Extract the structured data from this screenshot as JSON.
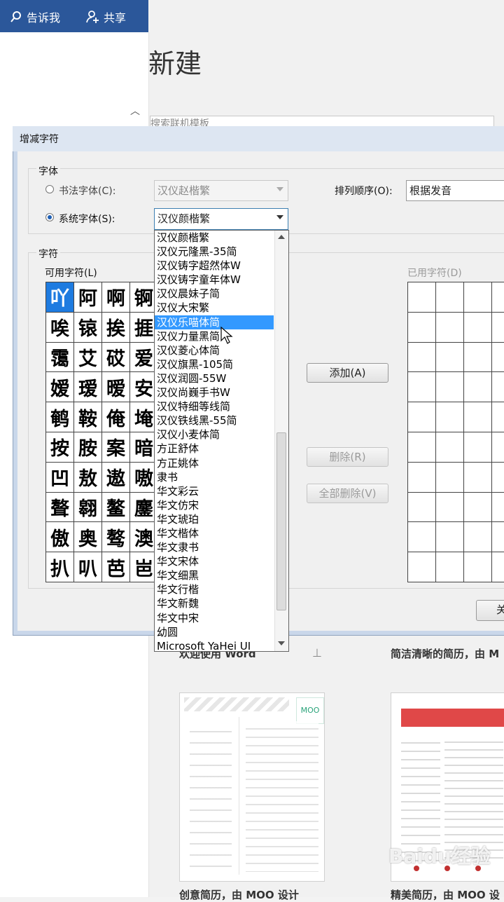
{
  "topbar": {
    "tell_me": "告诉我",
    "share": "共享"
  },
  "backstage": {
    "title": "新建",
    "search_placeholder": "搜索联机模板",
    "templates": [
      {
        "caption": "欢迎使用 Word"
      },
      {
        "caption": "简洁清晰的简历，由 M"
      },
      {
        "caption": "创意简历，由 MOO 设计"
      },
      {
        "caption": "精美简历，由 MOO 设"
      }
    ],
    "moo_logo": "MOO"
  },
  "dialog": {
    "title": "增减字符",
    "font_group_label": "字体",
    "calligraphy_radio": "书法字体(C):",
    "calligraphy_value": "汉仪赵楷繁",
    "system_radio": "系统字体(S):",
    "system_value": "汉仪颜楷繁",
    "sort_label": "排列顺序(O):",
    "sort_value": "根据发音",
    "chars_group_label": "字符",
    "available_label": "可用字符(L)",
    "used_label": "已用字符(D)",
    "add_button": "添加(A)",
    "delete_button": "删除(R)",
    "delete_all_button": "全部删除(V)",
    "close_button_fragment": "关",
    "available_chars": [
      "吖",
      "阿",
      "啊",
      "锕",
      "唉",
      "锿",
      "挨",
      "捱",
      "霭",
      "艾",
      "砹",
      "爱",
      "嫒",
      "瑷",
      "暧",
      "安",
      "鹌",
      "鞍",
      "俺",
      "埯",
      "按",
      "胺",
      "案",
      "暗",
      "凹",
      "敖",
      "遨",
      "嗷",
      "聱",
      "翱",
      "鳌",
      "鏖",
      "傲",
      "奥",
      "骜",
      "澳",
      "扒",
      "叭",
      "芭",
      "岜"
    ],
    "font_list": [
      "汉仪颜楷繁",
      "汉仪元隆黑-35简",
      "汉仪铸字超然体W",
      "汉仪铸字童年体W",
      "汉仪晨妹子简",
      "汉仪大宋繁",
      "汉仪乐喵体简",
      "汉仪力量黑简",
      "汉仪菱心体简",
      "汉仪旗黑-105简",
      "汉仪润圆-55W",
      "汉仪尚巍手书W",
      "汉仪特细等线简",
      "汉仪铁线黑-55简",
      "汉仪小麦体简",
      "方正舒体",
      "方正姚体",
      "隶书",
      "华文彩云",
      "华文仿宋",
      "华文琥珀",
      "华文楷体",
      "华文隶书",
      "华文宋体",
      "华文细黑",
      "华文行楷",
      "华文新魏",
      "华文中宋",
      "幼圆",
      "Microsoft YaHei UI"
    ],
    "highlighted_index": 6
  },
  "watermark": "Baidu经验",
  "colors": {
    "word_blue": "#2b579a",
    "highlight": "#3399ff",
    "moo_green": "#2aa37a",
    "red_banner": "#e04848"
  }
}
